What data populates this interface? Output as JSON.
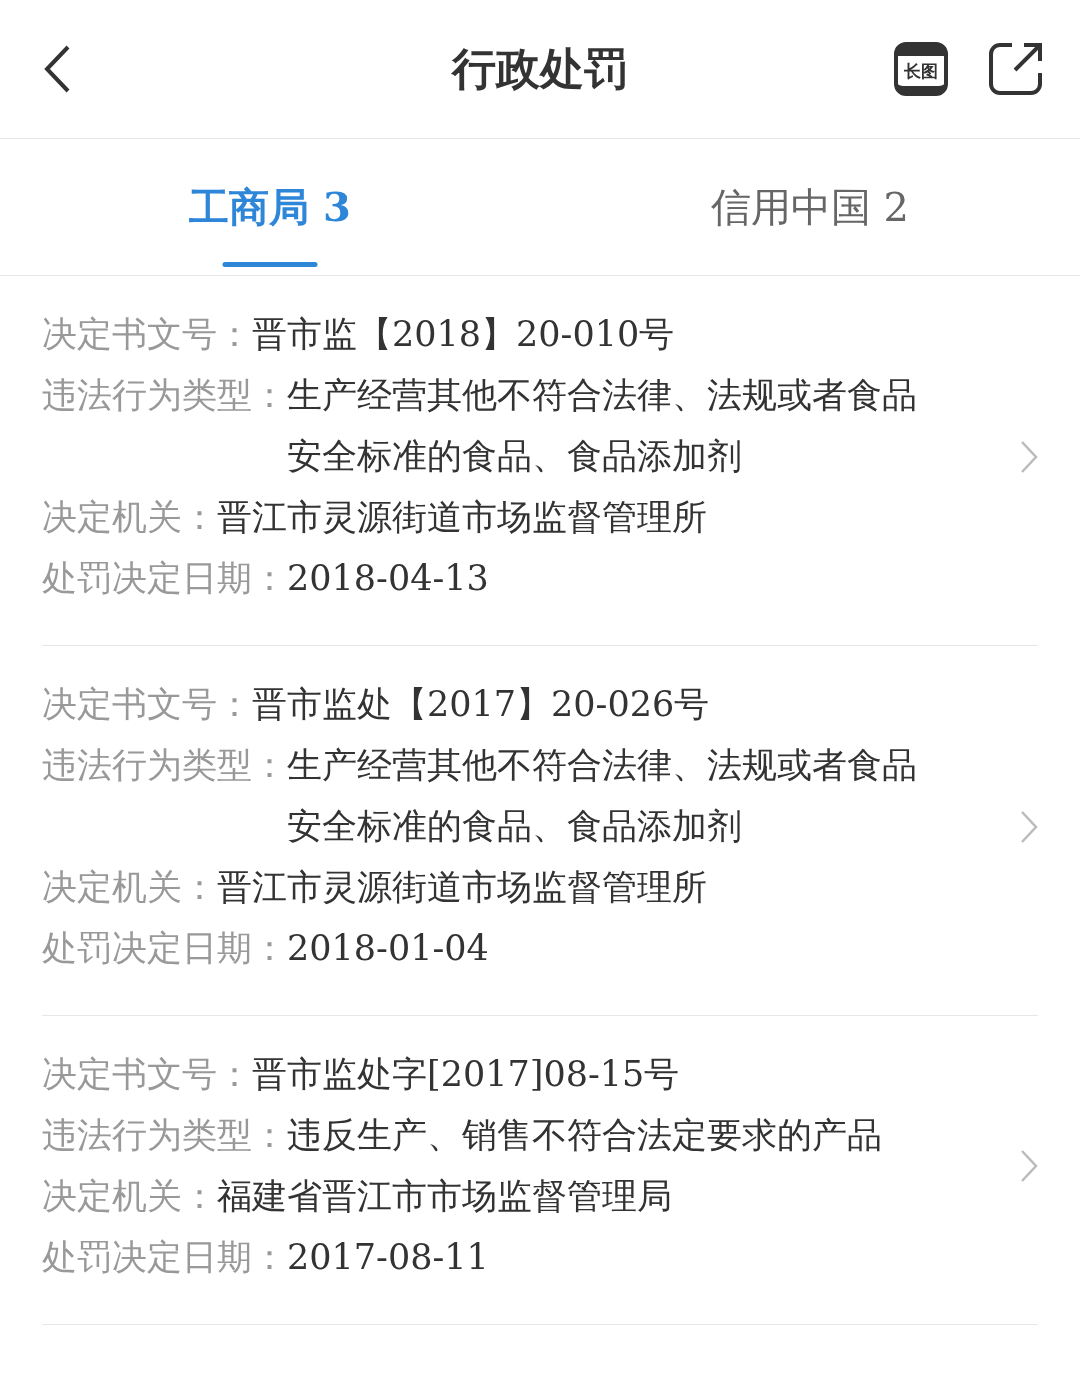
{
  "header": {
    "title": "行政处罚",
    "actions": [
      {
        "kind": "long-image",
        "label": "长图"
      },
      {
        "kind": "share"
      }
    ]
  },
  "tabs": [
    {
      "label": "工商局 3",
      "selected": true
    },
    {
      "label": "信用中国 2",
      "selected": false
    }
  ],
  "records": [
    {
      "fields": [
        {
          "label": "决定书文号：",
          "value": "晋市监【2018】20-010号"
        },
        {
          "label": "违法行为类型：",
          "value": "生产经营其他不符合法律、法规或者食品安全标准的食品、食品添加剂"
        },
        {
          "label": "决定机关：",
          "value": "晋江市灵源街道市场监督管理所"
        },
        {
          "label": "处罚决定日期：",
          "value": "2018-04-13"
        }
      ]
    },
    {
      "fields": [
        {
          "label": "决定书文号：",
          "value": "晋市监处【2017】20-026号"
        },
        {
          "label": "违法行为类型：",
          "value": "生产经营其他不符合法律、法规或者食品安全标准的食品、食品添加剂"
        },
        {
          "label": "决定机关：",
          "value": "晋江市灵源街道市场监督管理所"
        },
        {
          "label": "处罚决定日期：",
          "value": "2018-01-04"
        }
      ]
    },
    {
      "fields": [
        {
          "label": "决定书文号：",
          "value": "晋市监处字[2017]08-15号"
        },
        {
          "label": "违法行为类型：",
          "value": "违反生产、销售不符合法定要求的产品"
        },
        {
          "label": "决定机关：",
          "value": "福建省晋江市市场监督管理局"
        },
        {
          "label": "处罚决定日期：",
          "value": "2017-08-11"
        }
      ]
    }
  ]
}
